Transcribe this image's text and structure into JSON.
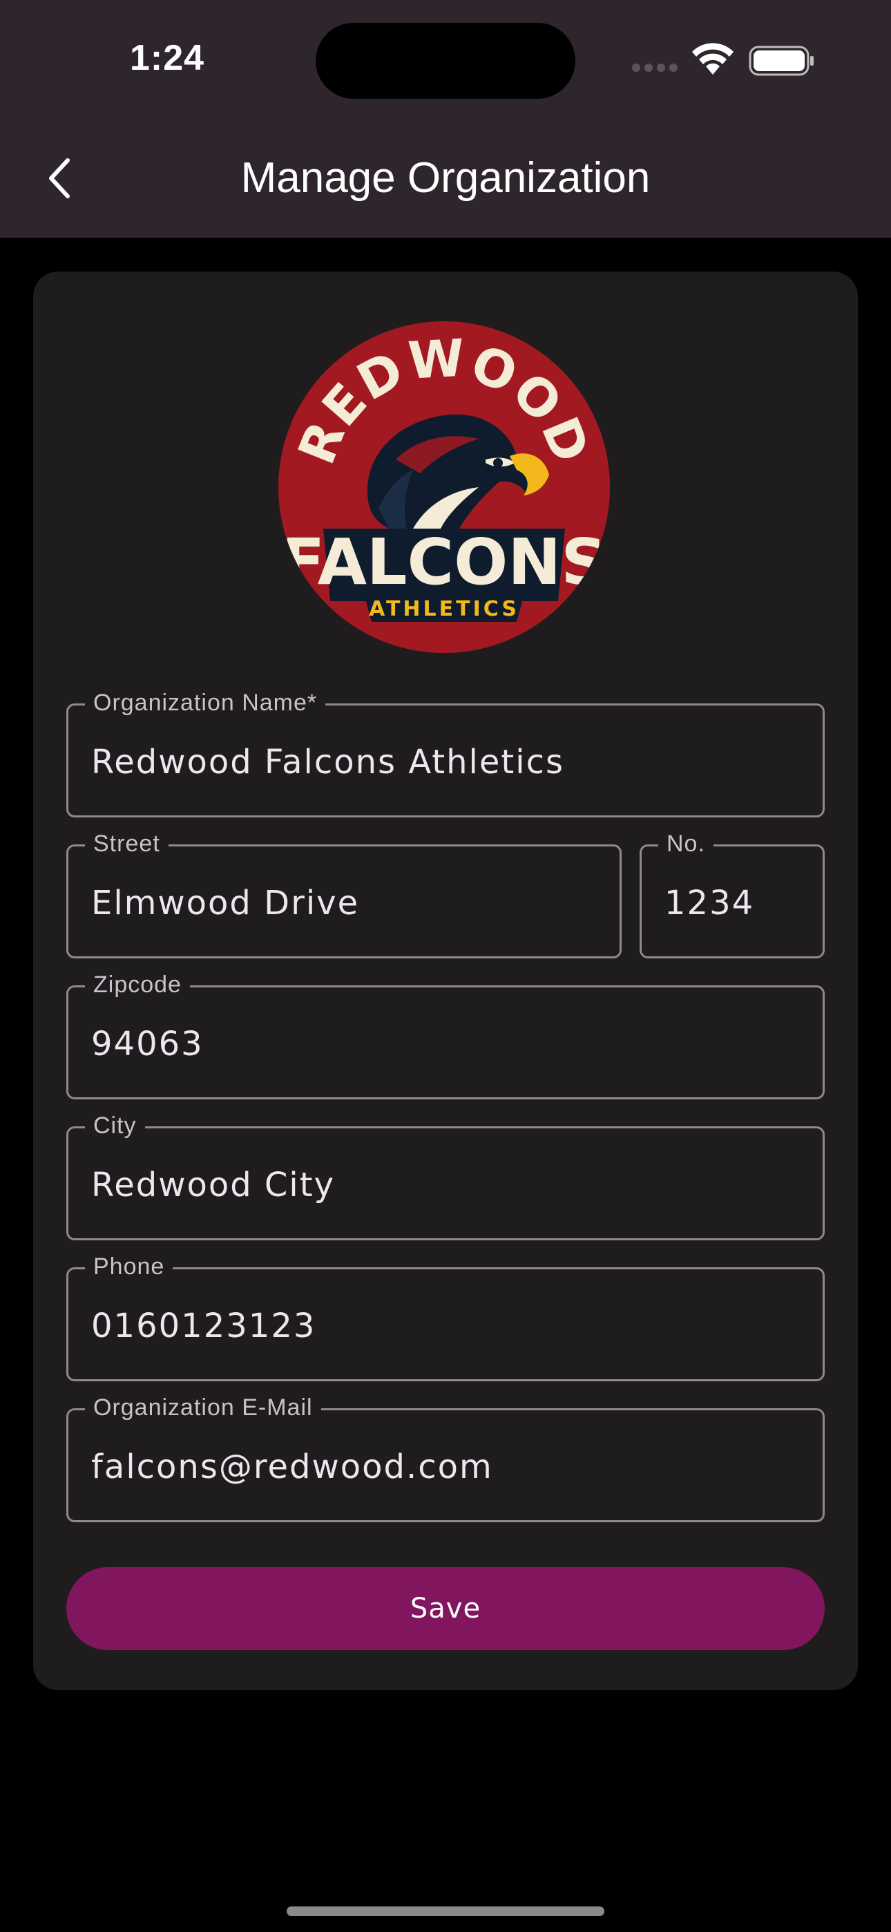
{
  "status_bar": {
    "time": "1:24",
    "icons": [
      "cellular-signal-icon",
      "wifi-icon",
      "battery-icon"
    ]
  },
  "nav": {
    "title": "Manage Organization",
    "back_icon": "chevron-left-icon"
  },
  "logo": {
    "top_text": "REDWOOD",
    "main_text": "FALCONS",
    "sub_text": "ATHLETICS",
    "colors": {
      "red": "#a31921",
      "navy": "#0f1c2e",
      "cream": "#f4ecd6",
      "gold": "#f2b81c"
    }
  },
  "form": {
    "org_name": {
      "label": "Organization Name*",
      "value": "Redwood Falcons Athletics"
    },
    "street": {
      "label": "Street",
      "value": "Elmwood Drive"
    },
    "number": {
      "label": "No.",
      "value": "1234"
    },
    "zipcode": {
      "label": "Zipcode",
      "value": "94063"
    },
    "city": {
      "label": "City",
      "value": "Redwood City"
    },
    "phone": {
      "label": "Phone",
      "value": "0160123123"
    },
    "email": {
      "label": "Organization E-Mail",
      "value": "falcons@redwood.com"
    },
    "save_label": "Save"
  },
  "colors": {
    "header_bg": "#2e262c",
    "card_bg": "#1f1c1e",
    "accent": "#82165e",
    "field_border": "#8f8893"
  }
}
